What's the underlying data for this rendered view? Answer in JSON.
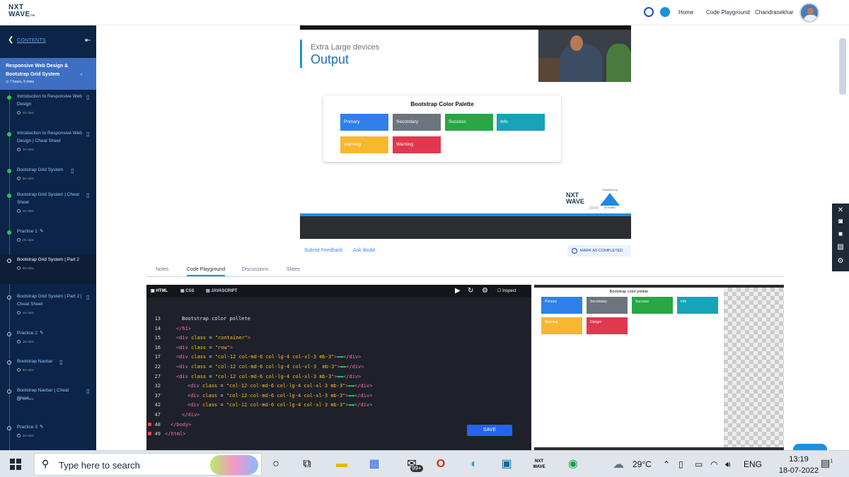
{
  "topbar": {
    "logo_line1": "NXT",
    "logo_line2": "WAVE",
    "logo_tm": "TM",
    "links": [
      "Home",
      "Code Playground"
    ],
    "user_name": "Chandrasekhar"
  },
  "sidebar": {
    "contents_label": "CONTENTS",
    "module": {
      "title": "Responsive Web Design & Bootstrap Grid System",
      "duration": "7 hours, 5 mins"
    },
    "items": [
      {
        "title": "Introduction to Responsive Web Design",
        "duration": "40 mins",
        "status": "done",
        "icon": "book-icon"
      },
      {
        "title": "Introduction to Responsive Web Design | Cheat Sheet",
        "duration": "10 mins",
        "status": "done",
        "icon": "book-icon"
      },
      {
        "title": "Bootstrap Grid System",
        "duration": "50 mins",
        "status": "done",
        "icon": "book-icon"
      },
      {
        "title": "Bootstrap Grid System | Cheat Sheet",
        "duration": "10 mins",
        "status": "done",
        "icon": "book-icon"
      },
      {
        "title": "Practice 1",
        "duration": "25 mins",
        "status": "done",
        "icon": "pencil-icon"
      },
      {
        "title": "Bootstrap Grid System | Part 2",
        "duration": "50 mins",
        "status": "current",
        "icon": "none"
      },
      {
        "title": "Bootstrap Grid System | Part 2 | Cheat Sheet",
        "duration": "15 mins",
        "status": "open",
        "icon": "book-icon"
      },
      {
        "title": "Practice 2",
        "duration": "25 mins",
        "status": "open",
        "icon": "pencil-icon"
      },
      {
        "title": "Bootstrap Navbar",
        "duration": "50 mins",
        "status": "open",
        "icon": "book-icon"
      },
      {
        "title": "Bootstrap Navbar | Cheat Sheet",
        "duration": "15 mins",
        "status": "open",
        "icon": "book-icon"
      },
      {
        "title": "Practice 3",
        "duration": "25 mins",
        "status": "open",
        "icon": "pencil-icon"
      }
    ]
  },
  "video": {
    "subtitle": "Extra Large devices",
    "title": "Output",
    "palette_title": "Bootstrap Color Palette",
    "boxes": [
      {
        "label": "Primary",
        "color": "#2f80ed"
      },
      {
        "label": "Secondary",
        "color": "#6c757d"
      },
      {
        "label": "Success",
        "color": "#28a745"
      },
      {
        "label": "Info",
        "color": "#17a2b8"
      },
      {
        "label": "Warning",
        "color": "#f7b731"
      },
      {
        "label": "Warning",
        "color": "#e0384f"
      }
    ],
    "nxt_line1": "NXT",
    "nxt_line2": "WAVE",
    "powered_by": "Powered by",
    "ib_hubs": "iB HUBS",
    "watermark": "20848"
  },
  "actions": {
    "submit_feedback": "Submit Feedback",
    "ask_doubt": "Ask doubt",
    "mark_completed": "MARK AS COMPLETED"
  },
  "tabs": [
    "Notes",
    "Code Playground",
    "Discussions",
    "Slides"
  ],
  "editor": {
    "tabs": [
      "HTML",
      "CSS",
      "JAVASCRIPT"
    ],
    "inspect_label": "Inspect",
    "save_label": "SAVE",
    "lines": [
      {
        "n": "13",
        "indent": 3,
        "parts": [
          [
            "txt",
            "Bootstrap color pollete"
          ]
        ]
      },
      {
        "n": "14",
        "indent": 2,
        "parts": [
          [
            "tag",
            "</h1>"
          ]
        ]
      },
      {
        "n": "15",
        "indent": 2,
        "parts": [
          [
            "tag",
            "<div "
          ],
          [
            "attr",
            "class"
          ],
          [
            "txt",
            " = "
          ],
          [
            "str",
            "\"container\""
          ],
          [
            "tag",
            ">"
          ]
        ]
      },
      {
        "n": "16",
        "indent": 2,
        "parts": [
          [
            "tag",
            "<div "
          ],
          [
            "attr",
            "class"
          ],
          [
            "txt",
            " = "
          ],
          [
            "str",
            "\"row\""
          ],
          [
            "tag",
            ">"
          ]
        ]
      },
      {
        "n": "17",
        "indent": 2,
        "parts": [
          [
            "tag",
            "<div "
          ],
          [
            "attr",
            "class"
          ],
          [
            "txt",
            " = "
          ],
          [
            "str",
            "\"col-12 col-md-6 col-lg-4 col-xl-3 mb-3\""
          ],
          [
            "tag",
            ">"
          ],
          [
            "dots",
            "▬▬"
          ],
          [
            "tag",
            "</div>"
          ]
        ]
      },
      {
        "n": "22",
        "indent": 2,
        "parts": [
          [
            "tag",
            "<div "
          ],
          [
            "attr",
            "class"
          ],
          [
            "txt",
            " = "
          ],
          [
            "str",
            "\"col-12 col-md-6 col-lg-4 col-xl-3  mb-3\""
          ],
          [
            "tag",
            ">"
          ],
          [
            "dots",
            "▬▬"
          ],
          [
            "tag",
            "</div>"
          ]
        ]
      },
      {
        "n": "27",
        "indent": 2,
        "parts": [
          [
            "tag",
            "<div "
          ],
          [
            "attr",
            "class"
          ],
          [
            "txt",
            " = "
          ],
          [
            "str",
            "\"col-12 col-md-6 col-lg-4 col-xl-3 mb-3\""
          ],
          [
            "tag",
            ">"
          ],
          [
            "dots",
            "▬▬"
          ],
          [
            "tag",
            "</div>"
          ]
        ]
      },
      {
        "n": "32",
        "indent": 4,
        "parts": [
          [
            "tag",
            "<div "
          ],
          [
            "attr",
            "class"
          ],
          [
            "txt",
            " = "
          ],
          [
            "str",
            "\"col-12 col-md-6 col-lg-4 col-xl-3 mb-3\""
          ],
          [
            "tag",
            ">"
          ],
          [
            "dots",
            "▬▬"
          ],
          [
            "tag",
            "</div>"
          ]
        ]
      },
      {
        "n": "37",
        "indent": 4,
        "parts": [
          [
            "tag",
            "<div "
          ],
          [
            "attr",
            "class"
          ],
          [
            "txt",
            " = "
          ],
          [
            "str",
            "\"col-12 col-md-6 col-lg-4 col-xl-3 mb-3\""
          ],
          [
            "tag",
            ">"
          ],
          [
            "dots",
            "▬▬"
          ],
          [
            "tag",
            "</div>"
          ]
        ]
      },
      {
        "n": "42",
        "indent": 4,
        "parts": [
          [
            "tag",
            "<div "
          ],
          [
            "attr",
            "class"
          ],
          [
            "txt",
            " = "
          ],
          [
            "str",
            "\"col-12 col-md-6 col-lg-4 col-xl-3 mb-3\""
          ],
          [
            "tag",
            ">"
          ],
          [
            "dots",
            "▬▬"
          ],
          [
            "tag",
            "</div>"
          ]
        ]
      },
      {
        "n": "47",
        "indent": 3,
        "parts": [
          [
            "tag",
            "</div>"
          ]
        ]
      },
      {
        "n": "48",
        "indent": 1,
        "parts": [
          [
            "tag",
            "</body>"
          ]
        ],
        "error": true
      },
      {
        "n": "49",
        "indent": 0,
        "parts": [
          [
            "tag",
            "</html>"
          ]
        ],
        "error": true
      }
    ]
  },
  "preview": {
    "title": "Bootstrap color pollete",
    "boxes": [
      {
        "label": "Primary",
        "color": "#2f80ed"
      },
      {
        "label": "Secondary",
        "color": "#6c757d"
      },
      {
        "label": "Success",
        "color": "#28a745"
      },
      {
        "label": "Info",
        "color": "#17a2b8"
      },
      {
        "label": "Warning",
        "color": "#f7b731"
      },
      {
        "label": "Danger",
        "color": "#e0384f"
      }
    ]
  },
  "taskbar": {
    "search_placeholder": "Type here to search",
    "mail_badge": "99+",
    "temperature": "29°C",
    "language": "ENG",
    "time": "13:19",
    "date": "18-07-2022",
    "notification_count": "1"
  }
}
